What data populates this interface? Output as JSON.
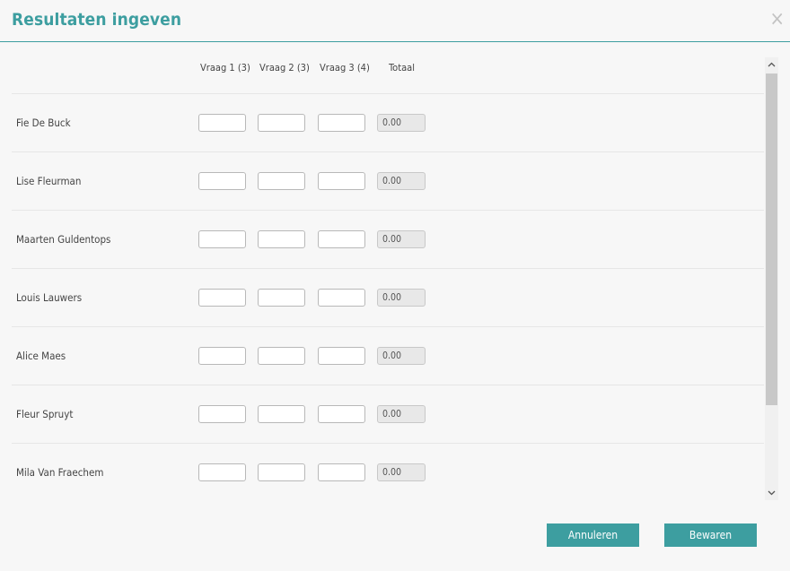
{
  "dialog": {
    "title": "Resultaten ingeven",
    "close_icon": "×"
  },
  "table": {
    "columns": [
      "Vraag 1 (3)",
      "Vraag 2 (3)",
      "Vraag 3 (4)",
      "Totaal"
    ],
    "rows": [
      {
        "name": "Fie De Buck",
        "q1": "",
        "q2": "",
        "q3": "",
        "total": "0.00"
      },
      {
        "name": "Lise Fleurman",
        "q1": "",
        "q2": "",
        "q3": "",
        "total": "0.00"
      },
      {
        "name": "Maarten Guldentops",
        "q1": "",
        "q2": "",
        "q3": "",
        "total": "0.00"
      },
      {
        "name": "Louis Lauwers",
        "q1": "",
        "q2": "",
        "q3": "",
        "total": "0.00"
      },
      {
        "name": "Alice Maes",
        "q1": "",
        "q2": "",
        "q3": "",
        "total": "0.00"
      },
      {
        "name": "Fleur Spruyt",
        "q1": "",
        "q2": "",
        "q3": "",
        "total": "0.00"
      },
      {
        "name": "Mila Van Fraechem",
        "q1": "",
        "q2": "",
        "q3": "",
        "total": "0.00"
      }
    ]
  },
  "scrollbar": {
    "up_icon": "chevron-up-icon",
    "down_icon": "chevron-down-icon"
  },
  "footer": {
    "cancel_label": "Annuleren",
    "save_label": "Bewaren"
  },
  "colors": {
    "accent": "#3d9ea0"
  }
}
